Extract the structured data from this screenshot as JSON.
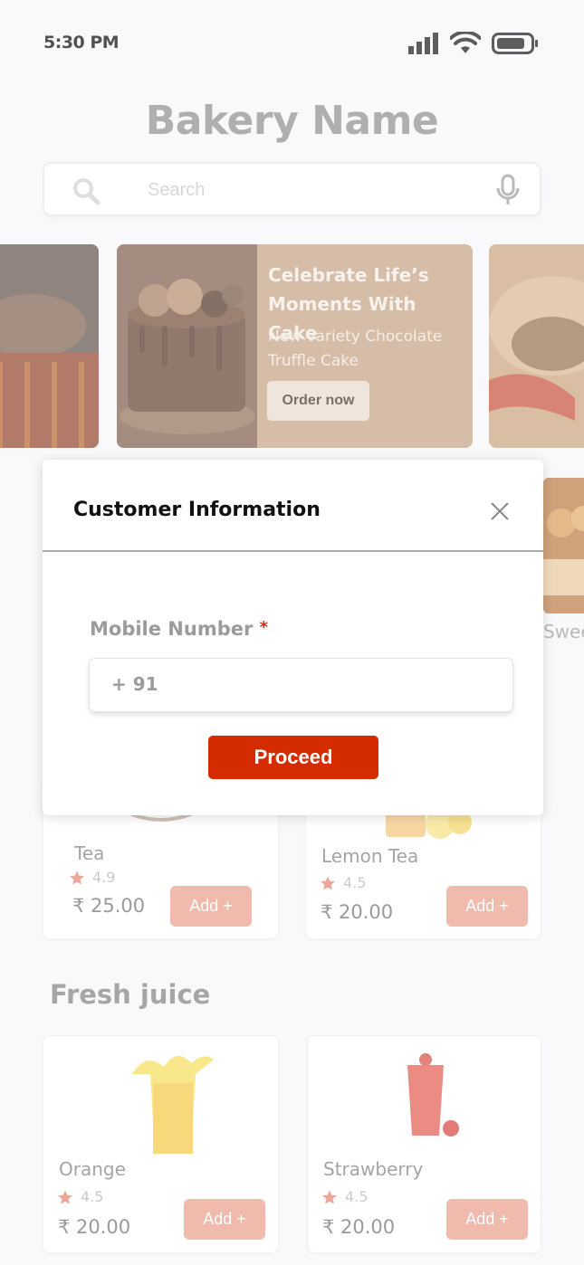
{
  "status_bar": {
    "time": "5:30 PM",
    "signal_icon": "cellular-signal-icon",
    "wifi_icon": "wifi-icon",
    "battery_icon": "battery-icon"
  },
  "header": {
    "title": "Bakery Name"
  },
  "search": {
    "placeholder": "Search",
    "search_icon": "search-icon",
    "mic_icon": "microphone-icon"
  },
  "banner": {
    "title": "Celebrate Life’s Moments With Cake",
    "subtitle": "New variety Chocolate Truffle Cake",
    "button_label": "Order now"
  },
  "category_peek": {
    "label": "Swee"
  },
  "products": [
    {
      "name": "Tea",
      "rating": "4.9",
      "price": "₹ 25.00",
      "add_label": "Add +"
    },
    {
      "name": "Lemon Tea",
      "rating": "4.5",
      "price": "₹ 20.00",
      "add_label": "Add +"
    }
  ],
  "fresh_juice": {
    "title": "Fresh juice",
    "items": [
      {
        "name": "Orange",
        "rating": "4.5",
        "price": "₹ 20.00",
        "add_label": "Add +"
      },
      {
        "name": "Strawberry",
        "rating": "4.5",
        "price": "₹ 20.00",
        "add_label": "Add +"
      }
    ]
  },
  "dialog": {
    "title": "Customer Information",
    "field_label": "Mobile Number",
    "required_mark": "*",
    "phone_prefix": "+ 91",
    "proceed_label": "Proceed"
  },
  "colors": {
    "accent": "#d42c00",
    "add_button": "#e99a86",
    "star": "#e47e6a",
    "banner_bg": "#c39e7f"
  }
}
